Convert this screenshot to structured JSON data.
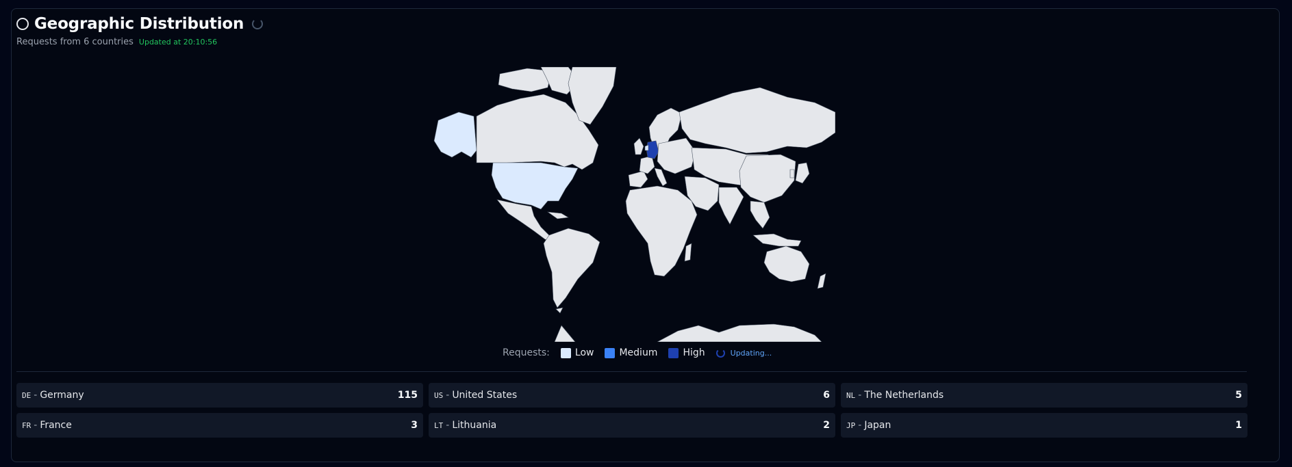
{
  "header": {
    "title": "Geographic Distribution",
    "subtitle": "Requests from 6 countries",
    "updated": "Updated at 20:10:56"
  },
  "legend": {
    "label": "Requests:",
    "items": [
      {
        "label": "Low",
        "color": "#dbeafe"
      },
      {
        "label": "Medium",
        "color": "#3b82f6"
      },
      {
        "label": "High",
        "color": "#1e40af"
      }
    ],
    "status": "Updating..."
  },
  "map": {
    "land_color": "#e5e7eb",
    "highlighted": [
      {
        "code": "DE",
        "level": "High"
      },
      {
        "code": "US",
        "level": "Low"
      }
    ]
  },
  "countries": [
    {
      "code": "DE",
      "name": "Germany",
      "count": "115"
    },
    {
      "code": "US",
      "name": "United States",
      "count": "6"
    },
    {
      "code": "NL",
      "name": "The Netherlands",
      "count": "5"
    },
    {
      "code": "FR",
      "name": "France",
      "count": "3"
    },
    {
      "code": "LT",
      "name": "Lithuania",
      "count": "2"
    },
    {
      "code": "JP",
      "name": "Japan",
      "count": "1"
    }
  ]
}
